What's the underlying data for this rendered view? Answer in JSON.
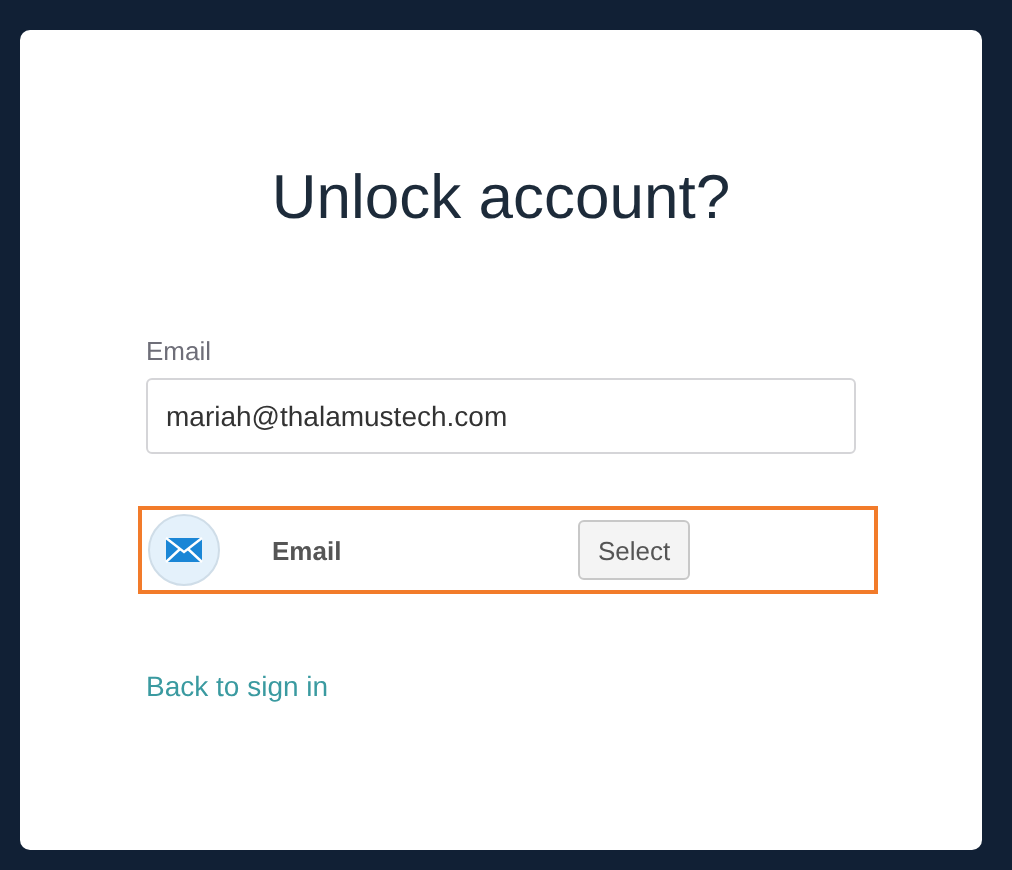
{
  "title": "Unlock account?",
  "email_field": {
    "label": "Email",
    "value": "mariah@thalamustech.com"
  },
  "factors": [
    {
      "kind": "email",
      "label": "Email",
      "button": "Select",
      "highlighted": true
    }
  ],
  "back_link": "Back to sign in"
}
